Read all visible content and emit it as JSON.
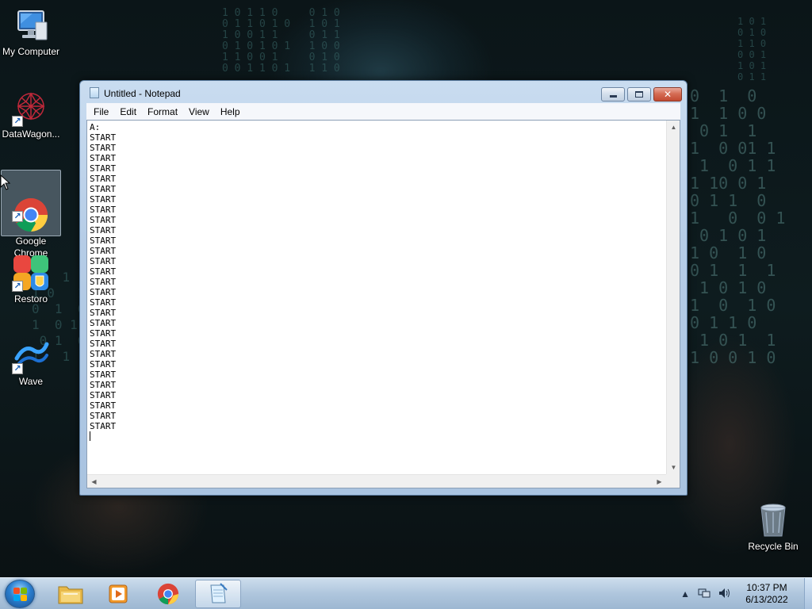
{
  "desktop": {
    "icons": [
      {
        "label": "My Computer"
      },
      {
        "label": "DataWagon..."
      },
      {
        "label": "Google\nChrome"
      },
      {
        "label": "Restoro"
      },
      {
        "label": "Wave"
      },
      {
        "label": "Recycle Bin"
      }
    ]
  },
  "notepad": {
    "title": "Untitled - Notepad",
    "menu": [
      "File",
      "Edit",
      "Format",
      "View",
      "Help"
    ],
    "content_lines": [
      "A:",
      "START",
      "START",
      "START",
      "START",
      "START",
      "START",
      "START",
      "START",
      "START",
      "START",
      "START",
      "START",
      "START",
      "START",
      "START",
      "START",
      "START",
      "START",
      "START",
      "START",
      "START",
      "START",
      "START",
      "START",
      "START",
      "START",
      "START",
      "START",
      "START"
    ]
  },
  "taskbar": {
    "clock_time": "10:37 PM",
    "clock_date": "6/13/2022"
  },
  "colors": {
    "accent": "#1a5fb4",
    "close_button": "#c24a32"
  }
}
